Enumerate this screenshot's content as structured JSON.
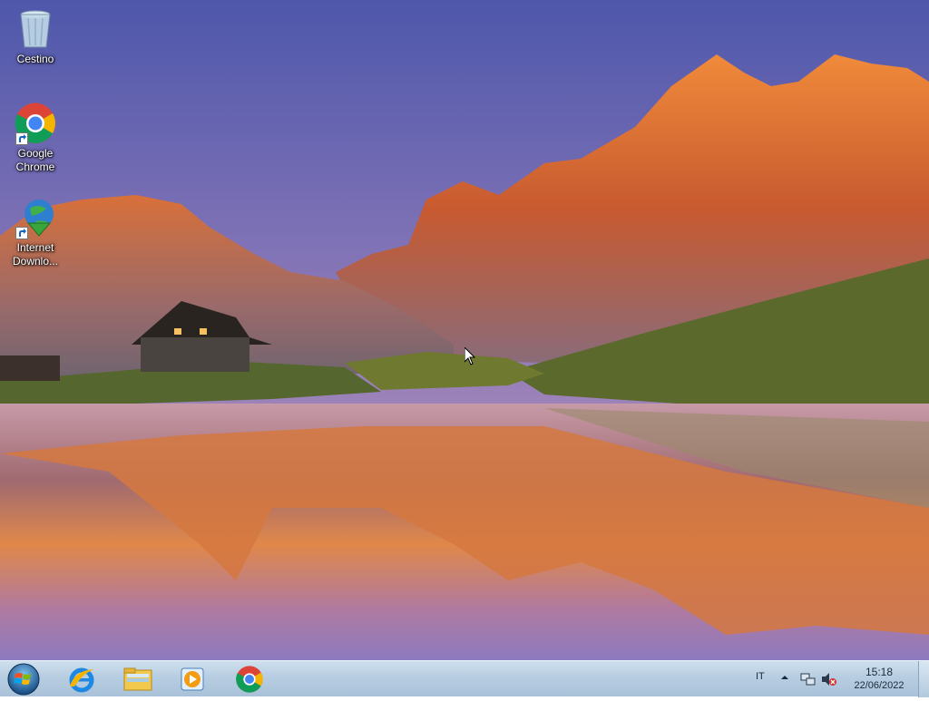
{
  "desktop": {
    "icons": [
      {
        "label": "Cestino",
        "icon": "recycle-bin-icon"
      },
      {
        "label": "Google Chrome",
        "icon": "chrome-icon"
      },
      {
        "label": "Internet Downlo...",
        "icon": "internet-download-manager-icon"
      }
    ]
  },
  "taskbar": {
    "apps": [
      {
        "icon": "internet-explorer-icon"
      },
      {
        "icon": "file-explorer-icon"
      },
      {
        "icon": "media-player-icon"
      },
      {
        "icon": "chrome-icon"
      }
    ],
    "tray": {
      "language": "IT",
      "time": "15:18",
      "date": "22/06/2022"
    }
  },
  "colors": {
    "sky_top": "#5a5fb0",
    "mountain_glow": "#e07a30",
    "taskbar": "#b7cde1"
  }
}
